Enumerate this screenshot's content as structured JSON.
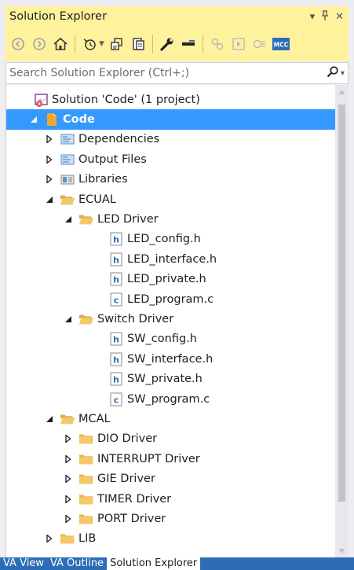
{
  "window": {
    "title": "Solution Explorer",
    "pin_glyph": "▾ ⊓",
    "close_glyph": "✕"
  },
  "toolbar": {
    "icons": [
      "back-icon",
      "forward-icon",
      "home-icon",
      "history-icon",
      "switch-views-icon",
      "sync-icon",
      "properties-icon",
      "collapse-icon",
      "show-all-files-icon",
      "preview-icon",
      "view-code-icon",
      "mcc-icon"
    ],
    "mcc_label": "MCC"
  },
  "search": {
    "placeholder": "Search Solution Explorer (Ctrl+;)",
    "value": ""
  },
  "tree": [
    {
      "label": "Solution 'Code' (1 project)",
      "depth": 0,
      "expander": "none",
      "icon": "solution",
      "selected": false
    },
    {
      "label": "Code",
      "depth": 0,
      "expander": "expanded",
      "icon": "project",
      "selected": true
    },
    {
      "label": "Dependencies",
      "depth": 1,
      "expander": "collapsed",
      "icon": "filter",
      "selected": false
    },
    {
      "label": "Output Files",
      "depth": 1,
      "expander": "collapsed",
      "icon": "filter",
      "selected": false
    },
    {
      "label": "Libraries",
      "depth": 1,
      "expander": "collapsed",
      "icon": "libraries",
      "selected": false
    },
    {
      "label": "ECUAL",
      "depth": 1,
      "expander": "expanded",
      "icon": "folder-open",
      "selected": false
    },
    {
      "label": "LED Driver",
      "depth": 2,
      "expander": "expanded",
      "icon": "folder-open",
      "selected": false
    },
    {
      "label": "LED_config.h",
      "depth": 3,
      "expander": "none",
      "icon": "h-file",
      "selected": false
    },
    {
      "label": "LED_interface.h",
      "depth": 3,
      "expander": "none",
      "icon": "h-file",
      "selected": false
    },
    {
      "label": "LED_private.h",
      "depth": 3,
      "expander": "none",
      "icon": "h-file",
      "selected": false
    },
    {
      "label": "LED_program.c",
      "depth": 3,
      "expander": "none",
      "icon": "c-file",
      "selected": false
    },
    {
      "label": "Switch Driver",
      "depth": 2,
      "expander": "expanded",
      "icon": "folder-open",
      "selected": false
    },
    {
      "label": "SW_config.h",
      "depth": 3,
      "expander": "none",
      "icon": "h-file",
      "selected": false
    },
    {
      "label": "SW_interface.h",
      "depth": 3,
      "expander": "none",
      "icon": "h-file",
      "selected": false
    },
    {
      "label": "SW_private.h",
      "depth": 3,
      "expander": "none",
      "icon": "h-file",
      "selected": false
    },
    {
      "label": "SW_program.c",
      "depth": 3,
      "expander": "none",
      "icon": "c-file",
      "selected": false
    },
    {
      "label": "MCAL",
      "depth": 1,
      "expander": "expanded",
      "icon": "folder-open",
      "selected": false
    },
    {
      "label": "DIO Driver",
      "depth": 2,
      "expander": "collapsed",
      "icon": "folder",
      "selected": false
    },
    {
      "label": "INTERRUPT Driver",
      "depth": 2,
      "expander": "collapsed",
      "icon": "folder",
      "selected": false
    },
    {
      "label": "GIE Driver",
      "depth": 2,
      "expander": "collapsed",
      "icon": "folder",
      "selected": false
    },
    {
      "label": "TIMER Driver",
      "depth": 2,
      "expander": "collapsed",
      "icon": "folder",
      "selected": false
    },
    {
      "label": "PORT Driver",
      "depth": 2,
      "expander": "collapsed",
      "icon": "folder",
      "selected": false
    },
    {
      "label": "LIB",
      "depth": 1,
      "expander": "collapsed",
      "icon": "folder",
      "selected": false
    }
  ],
  "tabs": [
    {
      "label": "VA View",
      "active": false
    },
    {
      "label": "VA Outline",
      "active": false
    },
    {
      "label": "Solution Explorer",
      "active": true
    }
  ],
  "colors": {
    "title_bar": "#fff29d",
    "selection": "#3399ff",
    "tab_strip": "#2d6db5",
    "folder": "#e8b84a"
  }
}
